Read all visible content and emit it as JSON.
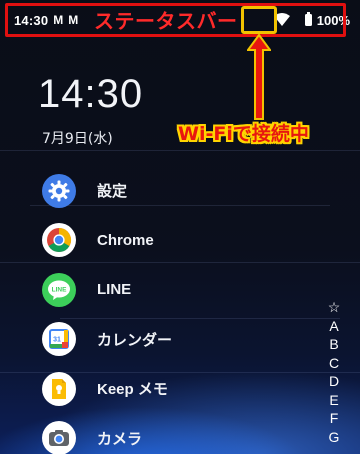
{
  "status_bar": {
    "time": "14:30",
    "mail_icons": [
      "gmail-icon",
      "gmail-icon"
    ],
    "battery_percent": "100%",
    "icons": [
      "wifi-icon",
      "battery-icon"
    ]
  },
  "annotation": {
    "status_bar_label": "ステータスバー",
    "wifi_label": "Wi-Fiで接続中",
    "frame_color": "#e01010",
    "highlight_color": "#f2c200"
  },
  "lock_clock": {
    "time": "14:30",
    "date": "7月9日(水)"
  },
  "apps": [
    {
      "label": "設定",
      "icon": "settings-gear-icon",
      "color": "#3f7be6"
    },
    {
      "label": "Chrome",
      "icon": "chrome-icon",
      "color": "#ffffff"
    },
    {
      "label": "LINE",
      "icon": "line-icon",
      "color": "#3ccf5a"
    },
    {
      "label": "カレンダー",
      "icon": "calendar-icon",
      "color": "#ffffff"
    },
    {
      "label": "Keep メモ",
      "icon": "keep-icon",
      "color": "#ffffff"
    },
    {
      "label": "カメラ",
      "icon": "camera-icon",
      "color": "#ffffff"
    }
  ],
  "alphabet_index": [
    "☆",
    "A",
    "B",
    "C",
    "D",
    "E",
    "F",
    "G"
  ]
}
